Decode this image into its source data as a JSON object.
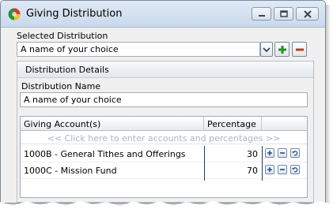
{
  "window": {
    "title": "Giving Distribution"
  },
  "selected": {
    "label": "Selected Distribution",
    "value": "A name of your choice"
  },
  "details": {
    "title": "Distribution Details",
    "name_label": "Distribution Name",
    "name_value": "A name of your choice"
  },
  "grid": {
    "columns": [
      "Giving Account(s)",
      "Percentage"
    ],
    "new_row_hint": "<< Click here to enter accounts and percentages >>",
    "rows": [
      {
        "account": "1000B - General Tithes and Offerings",
        "percentage": "30"
      },
      {
        "account": "1000C - Mission Fund",
        "percentage": "70"
      }
    ]
  },
  "colors": {
    "add_green": "#2f8a2f",
    "remove_red": "#c0392b",
    "grid_accent": "#1a3c78"
  }
}
